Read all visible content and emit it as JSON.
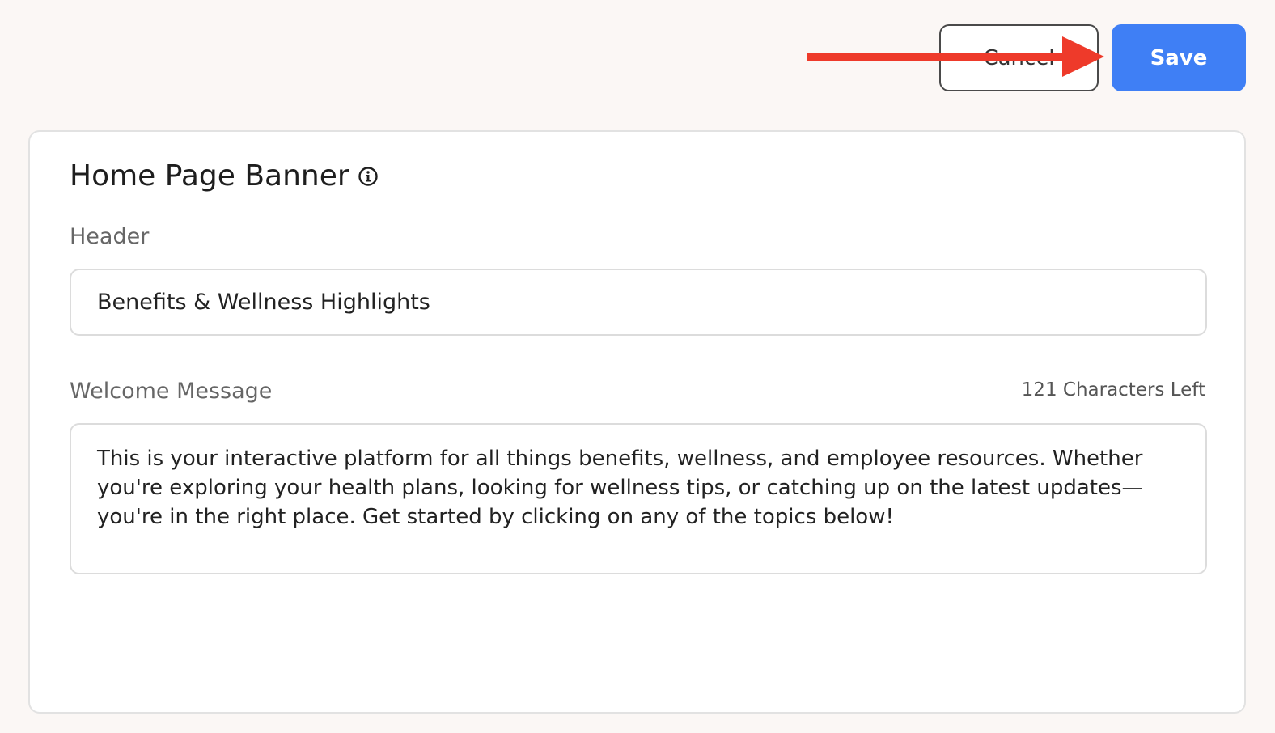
{
  "toolbar": {
    "cancel_label": "Cancel",
    "save_label": "Save",
    "save_color": "#3f7ff5"
  },
  "annotation": {
    "arrow_color": "#ee3a2a",
    "arrow_icon": "arrow-right-icon"
  },
  "card": {
    "title": "Home Page Banner",
    "title_icon": "info-icon",
    "header_field": {
      "label": "Header",
      "value": "Benefits & Wellness Highlights"
    },
    "welcome_field": {
      "label": "Welcome Message",
      "char_count": "121 Characters Left",
      "value": "This is your interactive platform for all things benefits, wellness, and employee resources. Whether you're exploring your health plans, looking for wellness tips, or catching up on the latest updates—you're in the right place. Get started by clicking on any of the topics below!"
    }
  }
}
